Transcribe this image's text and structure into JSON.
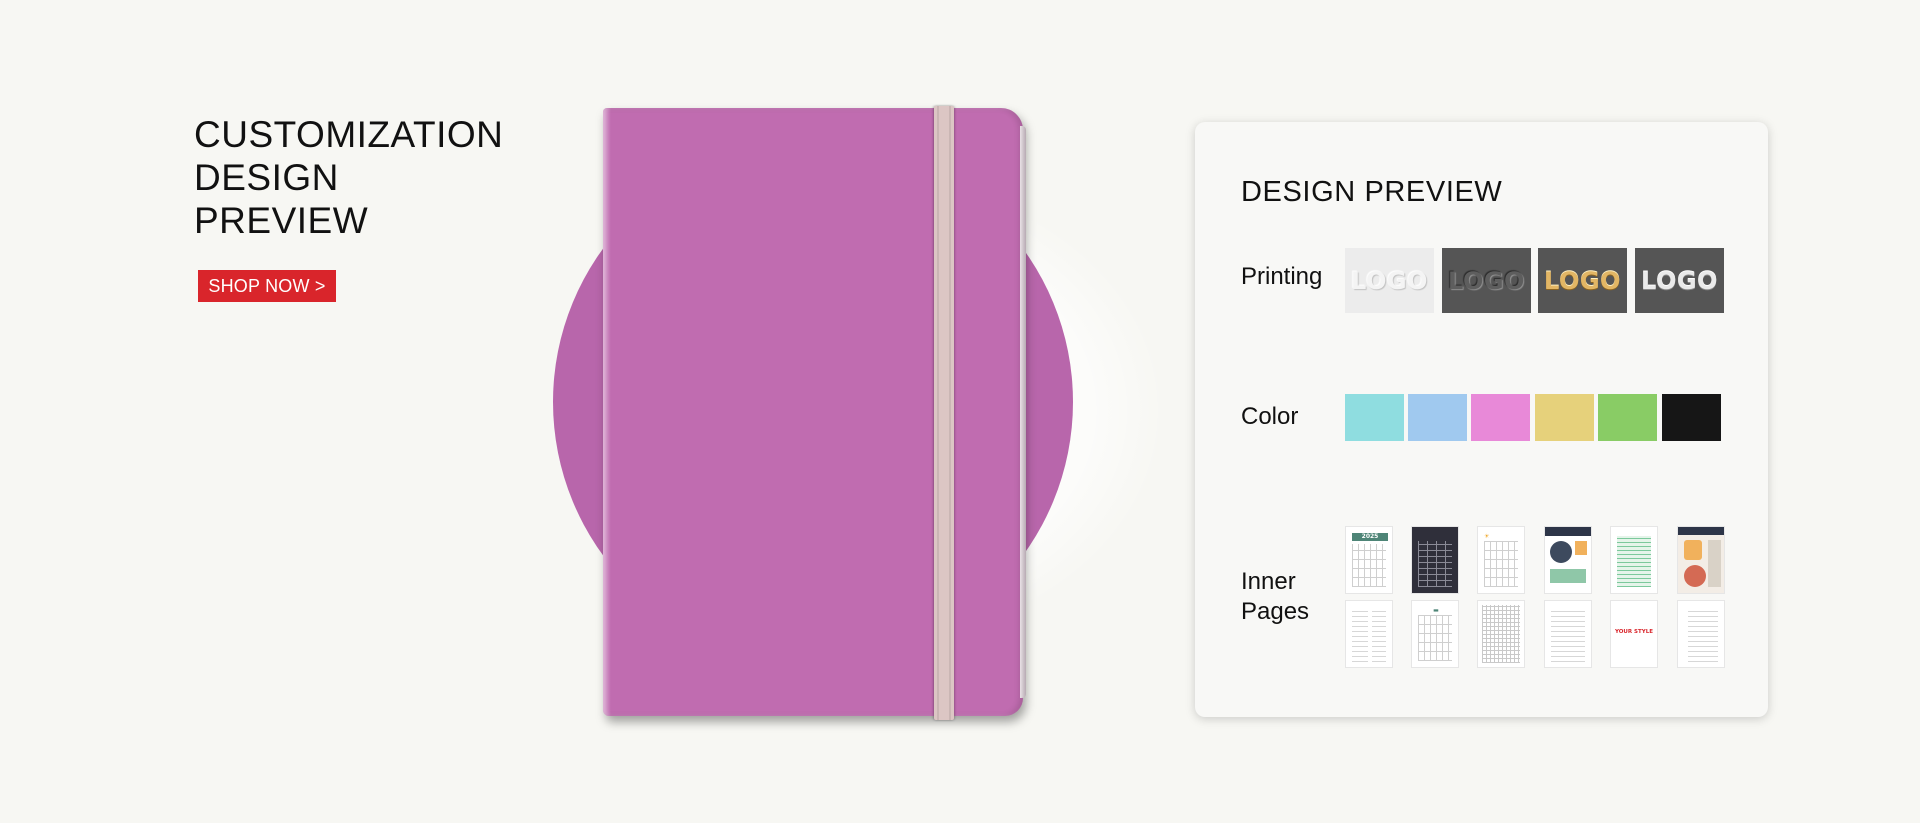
{
  "hero": {
    "title_lines": [
      "CUSTOMIZATION",
      "DESIGN",
      "PREVIEW"
    ],
    "shop_button": "SHOP NOW >"
  },
  "product": {
    "notebook_color": "#c06cb0",
    "circle_color": "#b866ab",
    "strap_color": "#dcc6c4"
  },
  "panel": {
    "title": "DESIGN PREVIEW",
    "printing": {
      "label": "Printing",
      "options": [
        {
          "text": "LOGO",
          "style": "blind-emboss"
        },
        {
          "text": "LOGO",
          "style": "deboss-dark"
        },
        {
          "text": "LOGO",
          "style": "gold-foil"
        },
        {
          "text": "LOGO",
          "style": "silver-foil"
        }
      ]
    },
    "color": {
      "label": "Color",
      "swatches": [
        "#8fdde0",
        "#a0c9ef",
        "#e889d8",
        "#e6d17b",
        "#89cc65",
        "#161616"
      ]
    },
    "inner_pages": {
      "label_lines": [
        "Inner",
        "Pages"
      ],
      "pages": [
        {
          "kind": "calendar-year",
          "header": "2025"
        },
        {
          "kind": "dark-planner",
          "header": ""
        },
        {
          "kind": "monthly-grid",
          "header": ""
        },
        {
          "kind": "vision-board",
          "header": ""
        },
        {
          "kind": "table-green",
          "header": ""
        },
        {
          "kind": "collage",
          "header": ""
        },
        {
          "kind": "weekly",
          "header": ""
        },
        {
          "kind": "monthly-calendar",
          "header": ""
        },
        {
          "kind": "graph",
          "header": ""
        },
        {
          "kind": "lined",
          "header": ""
        },
        {
          "kind": "custom",
          "text": "YOUR STYLE"
        },
        {
          "kind": "lined-plain",
          "header": ""
        }
      ]
    }
  }
}
